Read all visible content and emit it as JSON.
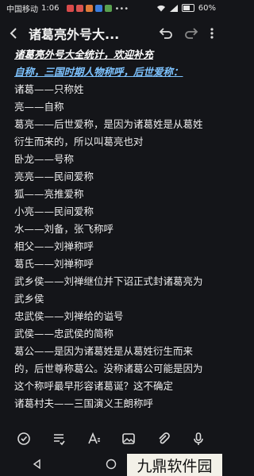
{
  "status_bar": {
    "carrier": "中国移动",
    "time": "1:06",
    "battery_percent": "60%",
    "battery_level": 0.6
  },
  "header": {
    "title": "诸葛亮外号大..."
  },
  "note": {
    "lines": [
      "诸葛亮外号大全统计，欢迎补充",
      "自称，三国时期人物称呼，后世爱称：",
      "诸葛——只称姓",
      "亮——自称",
      "葛亮——后世爱称，是因为诸葛姓是从葛姓",
      "衍生而来的，所以叫葛亮也对",
      "卧龙——号称",
      "亮亮——民间爱称",
      "狐——亮推爱称",
      "小亮——民间爱称",
      "水——刘备，张飞称呼",
      "相父——刘禅称呼",
      "葛氏——刘禅称呼",
      "武乡侯——刘禅继位并下诏正式封诸葛亮为",
      "武乡侯",
      "忠武侯——刘禅给的谥号",
      "武侯——忠武侯的简称",
      "葛公——是因为诸葛姓是从葛姓衍生而来",
      "的，后世尊称葛公。没称诸葛公可能是因为",
      "这个称呼最早形容诸葛诞？这不确定",
      "诸葛村夫——三国演义王朗称呼"
    ]
  },
  "watermark": {
    "text": "九鼎软件园"
  },
  "icons": {
    "back": "back-arrow-icon",
    "undo": "undo-icon",
    "redo": "redo-icon",
    "more": "more-vertical-icon",
    "toolbar": [
      "text-style-icon",
      "checklist-icon",
      "format-icon",
      "image-icon",
      "attachment-icon",
      "microphone-icon"
    ],
    "nav": [
      "nav-back-icon",
      "nav-home-icon",
      "nav-recents-icon"
    ]
  },
  "colors": {
    "background": "#141519",
    "text": "#ececec",
    "heading_blue": "#7ec3ff"
  }
}
